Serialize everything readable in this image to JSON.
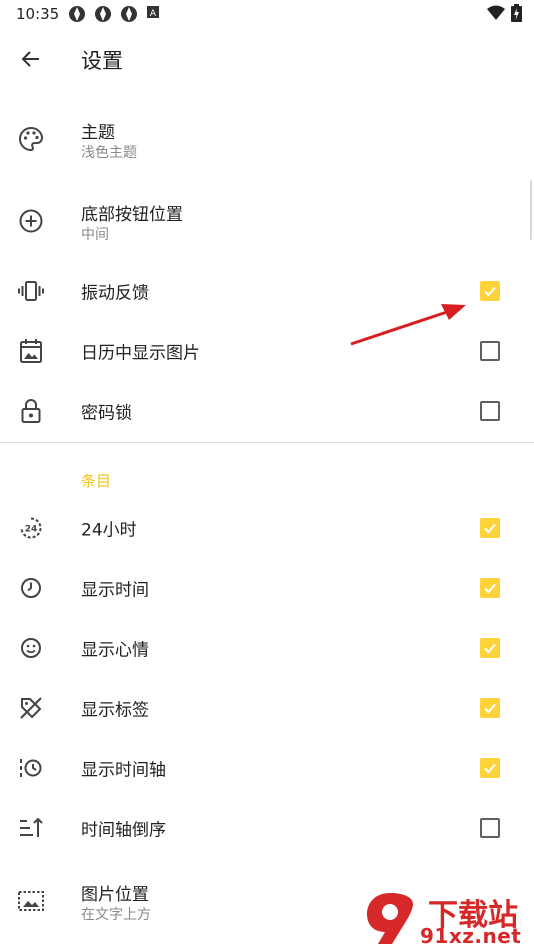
{
  "status_bar": {
    "time": "10:35"
  },
  "header": {
    "title": "设置"
  },
  "settings": [
    {
      "label": "主题",
      "sub": "浅色主题",
      "icon": "palette-icon"
    },
    {
      "label": "底部按钮位置",
      "sub": "中间",
      "icon": "add-circle-icon"
    },
    {
      "label": "振动反馈",
      "checked": true,
      "icon": "vibration-icon"
    },
    {
      "label": "日历中显示图片",
      "checked": false,
      "icon": "calendar-icon"
    },
    {
      "label": "密码锁",
      "checked": false,
      "icon": "lock-icon"
    }
  ],
  "entries": {
    "section_label": "条目",
    "items": [
      {
        "label": "24小时",
        "checked": true,
        "icon": "hours-24-icon"
      },
      {
        "label": "显示时间",
        "checked": true,
        "icon": "clock-icon"
      },
      {
        "label": "显示心情",
        "checked": true,
        "icon": "smiley-icon"
      },
      {
        "label": "显示标签",
        "checked": true,
        "icon": "tag-icon"
      },
      {
        "label": "显示时间轴",
        "checked": true,
        "icon": "timeline-icon"
      },
      {
        "label": "时间轴倒序",
        "checked": false,
        "icon": "sort-icon"
      },
      {
        "label": "图片位置",
        "sub": "在文字上方",
        "icon": "image-position-icon"
      }
    ]
  },
  "colors": {
    "accent": "#fdd33a",
    "section_header": "#f5c518",
    "annotation_arrow": "#d81e1e"
  },
  "watermark": {
    "text": "下载站",
    "url": "91xz.net"
  }
}
